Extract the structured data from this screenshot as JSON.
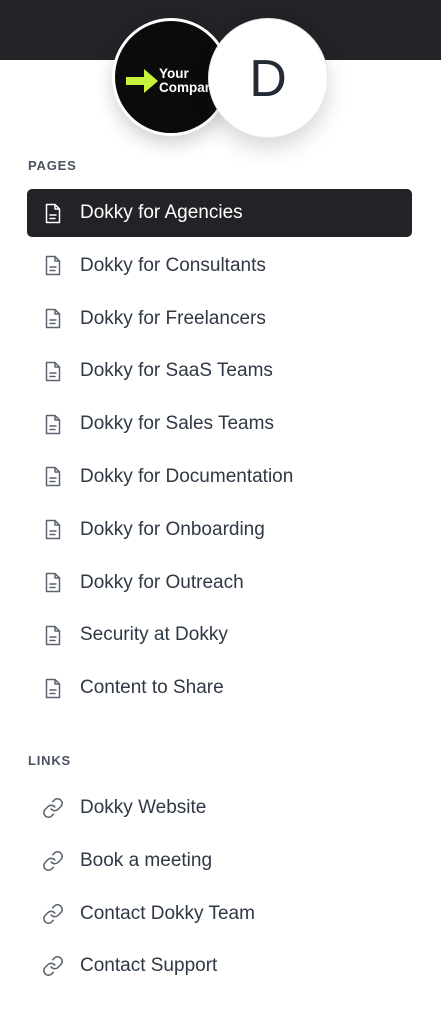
{
  "header": {
    "company_logo_text_1": "Your",
    "company_logo_text_2": "Company",
    "dokky_logo_letter": "D"
  },
  "pages": {
    "heading": "PAGES",
    "items": [
      {
        "label": "Dokky for Agencies",
        "active": true
      },
      {
        "label": "Dokky for Consultants",
        "active": false
      },
      {
        "label": "Dokky for Freelancers",
        "active": false
      },
      {
        "label": "Dokky for SaaS Teams",
        "active": false
      },
      {
        "label": "Dokky for Sales Teams",
        "active": false
      },
      {
        "label": "Dokky for Documentation",
        "active": false
      },
      {
        "label": "Dokky for Onboarding",
        "active": false
      },
      {
        "label": "Dokky for Outreach",
        "active": false
      },
      {
        "label": "Security at Dokky",
        "active": false
      },
      {
        "label": "Content to Share",
        "active": false
      }
    ],
    "icon": "document-icon"
  },
  "links": {
    "heading": "LINKS",
    "items": [
      {
        "label": "Dokky Website"
      },
      {
        "label": "Book a meeting"
      },
      {
        "label": "Contact Dokky Team"
      },
      {
        "label": "Contact Support"
      }
    ],
    "icon": "link-icon"
  },
  "colors": {
    "topbar": "#222326",
    "active_bg": "#222326",
    "logo_arrow": "#c7f43b",
    "text": "#2f3845"
  }
}
